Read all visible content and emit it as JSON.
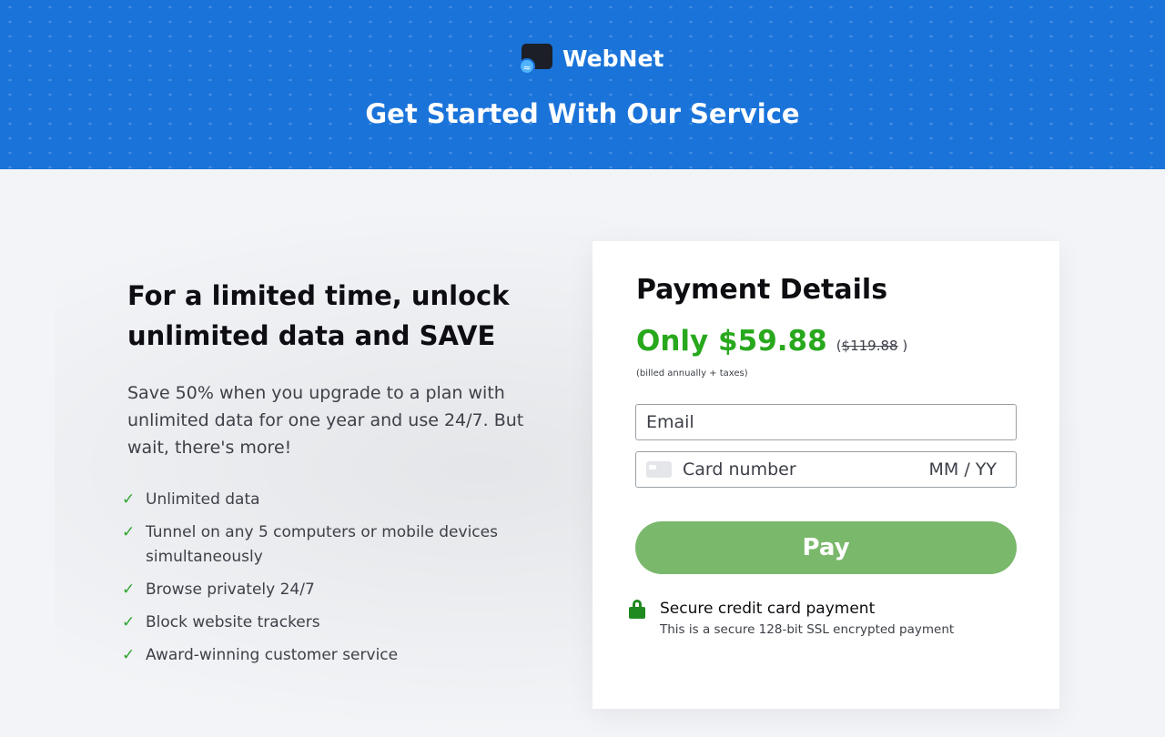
{
  "header": {
    "brand": "WebNet",
    "title": "Get Started With Our Service"
  },
  "promo": {
    "headline": "For a limited time, unlock unlimited data and SAVE",
    "description": "Save 50% when you upgrade to a plan with unlimited data for one year and use 24/7. But wait, there's more!",
    "features": [
      "Unlimited data",
      "Tunnel on any 5 computers or mobile devices simultaneously",
      "Browse privately 24/7",
      "Block website trackers",
      "Award-winning customer service"
    ]
  },
  "payment": {
    "title": "Payment Details",
    "price": "Only $59.88",
    "old_price_prefix": "(",
    "old_price": "$119.88",
    "old_price_suffix": " )",
    "billing_note": "(billed annually + taxes)",
    "email_placeholder": "Email",
    "card_placeholder": "Card number",
    "expiry_placeholder": "MM / YY",
    "pay_label": "Pay",
    "secure_title": "Secure credit card payment",
    "secure_subtitle": "This is a secure 128-bit SSL encrypted payment"
  },
  "colors": {
    "header_blue": "#1a73d9",
    "price_green": "#28a81d",
    "pay_button": "#7ab86c",
    "check_green": "#2ea52e"
  },
  "icons": [
    "wifi-icon",
    "check-icon",
    "credit-card-icon",
    "lock-icon"
  ]
}
